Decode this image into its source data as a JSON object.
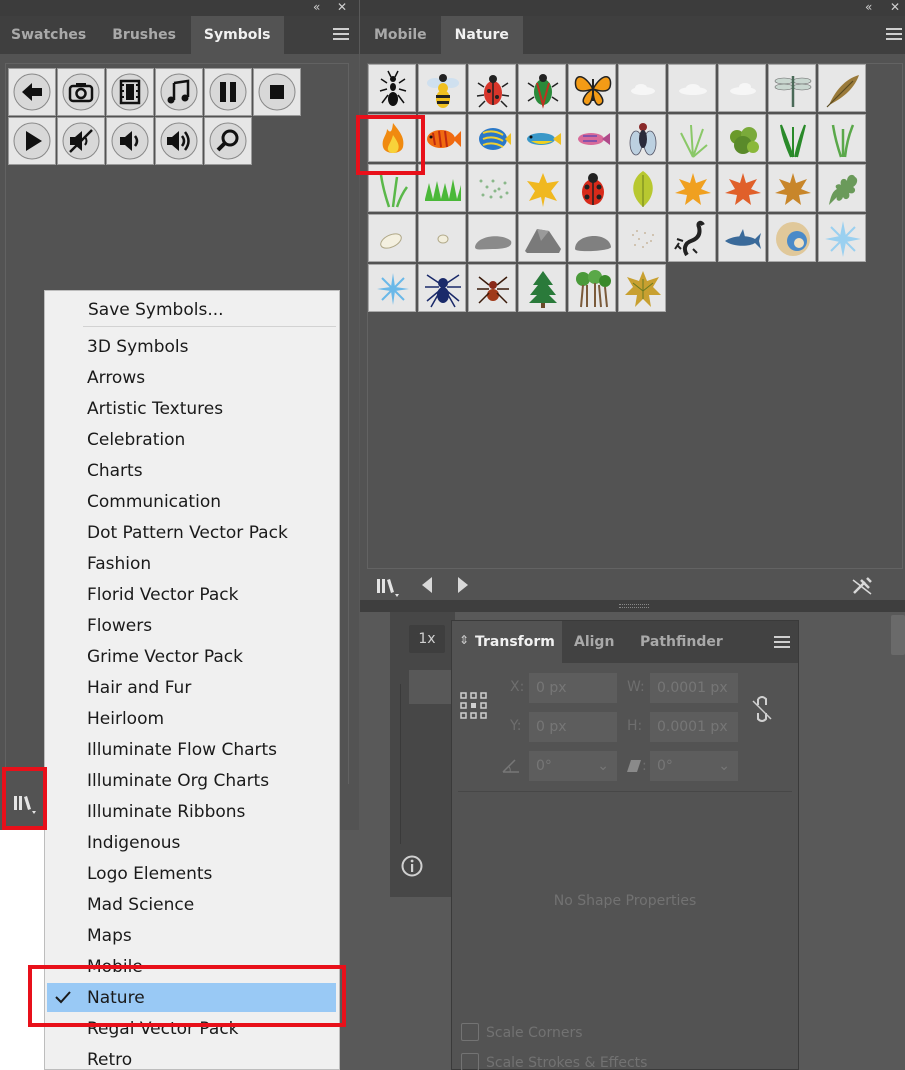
{
  "left_panel": {
    "tabs": [
      "Swatches",
      "Brushes",
      "Symbols"
    ],
    "active_tab": "Symbols",
    "symbols": [
      "arrow-left-icon",
      "camera-icon",
      "film-icon",
      "music-note-icon",
      "pause-icon",
      "stop-icon",
      "play-icon",
      "mute-icon",
      "volume-low-icon",
      "volume-high-icon",
      "search-icon"
    ]
  },
  "right_panel": {
    "tabs": [
      "Mobile",
      "Nature"
    ],
    "active_tab": "Nature",
    "symbols": [
      "ant",
      "wasp",
      "beetle",
      "green-beetle",
      "butterfly",
      "cloud-1",
      "cloud-2",
      "cloud-3",
      "dragonfly",
      "feather",
      "fire",
      "orange-fish",
      "angelfish",
      "blue-fish",
      "pink-fish",
      "fly",
      "grass-1",
      "bush",
      "grass-2",
      "grass-3",
      "grass-4",
      "grass-5",
      "pebbles",
      "yellow-leaf",
      "ladybug",
      "green-leaf",
      "orange-leaf",
      "red-leaf",
      "brown-leaf",
      "oak-leaf",
      "white-stone",
      "small-stone",
      "flat-rock",
      "gray-rock",
      "round-rock",
      "sand",
      "scorpion",
      "shark",
      "shell",
      "snowflake-1",
      "snowflake-2",
      "spider",
      "red-spider",
      "pine-tree",
      "trees",
      "maple-leaf"
    ],
    "selected_symbol": "fire"
  },
  "zoom": {
    "label": "1x"
  },
  "transform": {
    "tabs": [
      "Transform",
      "Align",
      "Pathfinder"
    ],
    "x_label": "X:",
    "x_value": "0 px",
    "y_label": "Y:",
    "y_value": "0 px",
    "w_label": "W:",
    "w_value": "0.0001 px",
    "h_label": "H:",
    "h_value": "0.0001 px",
    "angle_value": "0°",
    "shear_value": "0°",
    "no_shape": "No Shape Properties",
    "scale_corners": "Scale Corners",
    "scale_strokes": "Scale Strokes & Effects"
  },
  "menu": {
    "save": "Save Symbols...",
    "items": [
      "3D Symbols",
      "Arrows",
      "Artistic Textures",
      "Celebration",
      "Charts",
      "Communication",
      "Dot Pattern Vector Pack",
      "Fashion",
      "Florid Vector Pack",
      "Flowers",
      "Grime Vector Pack",
      "Hair and Fur",
      "Heirloom",
      "Illuminate Flow Charts",
      "Illuminate Org Charts",
      "Illuminate Ribbons",
      "Indigenous",
      "Logo Elements",
      "Mad Science",
      "Maps",
      "Mobile",
      "Nature",
      "Regal Vector Pack",
      "Retro"
    ],
    "checked": "Nature"
  },
  "colors": {
    "highlight": "#99c9f5",
    "annotation_red": "#e8101a",
    "panel_bg": "#535353"
  }
}
